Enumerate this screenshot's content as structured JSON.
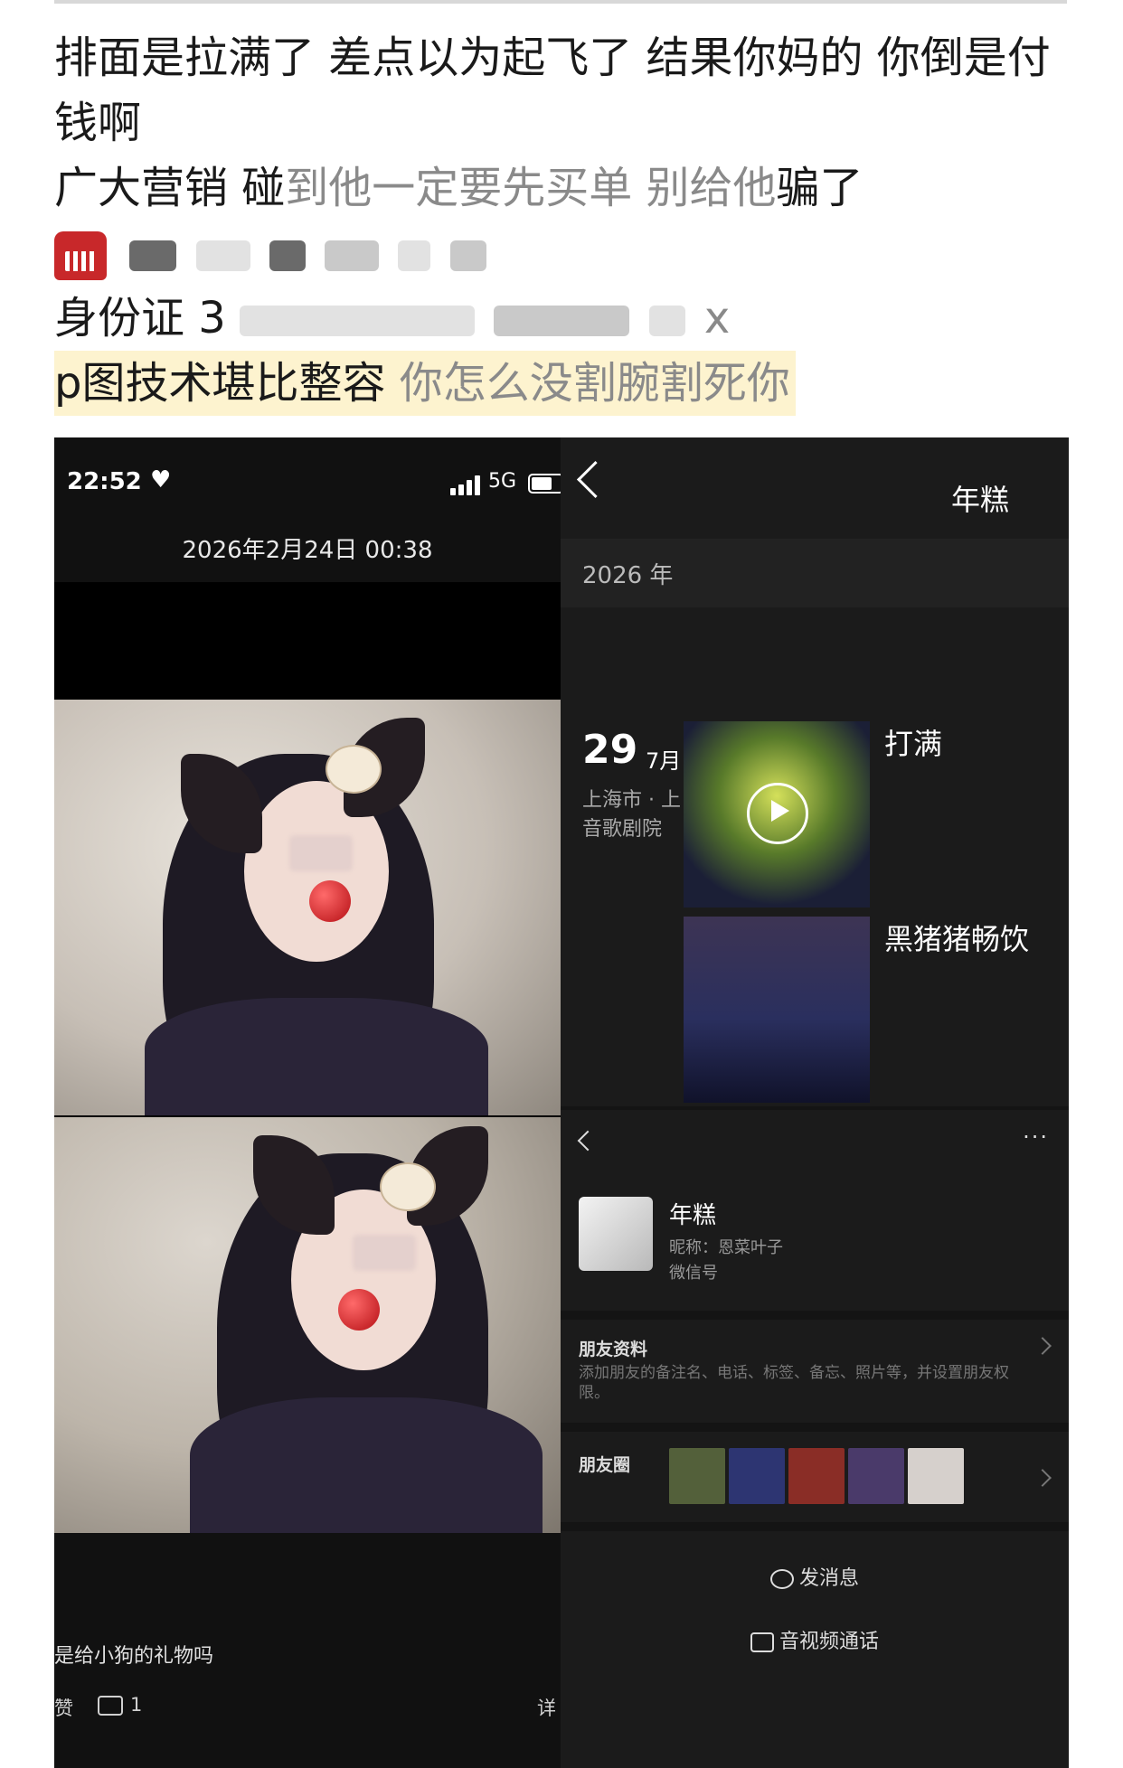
{
  "post": {
    "line1": "排面是拉满了 差点以为起飞了 结果你妈的 你倒是付钱啊",
    "line2a": "广大营销 碰",
    "line2b": "到他一定要先买单 别给他",
    "line2c": "骗了",
    "phone_icon": "telephone-icon",
    "id_prefix": "身份证 3",
    "id_suffix": "x",
    "line5a": "p图技术堪比整容",
    "line5b": " 你怎么没割腕割死你"
  },
  "left_screen": {
    "status_time": "22:52",
    "status_network": "5G",
    "date": "2026年2月24日 00:38",
    "caption": "是给小狗的礼物吗",
    "like_label": "赞",
    "comment_count": "1",
    "detail_label": "详"
  },
  "right_screen": {
    "title": "年糕",
    "year": "2026 年",
    "day": "29",
    "month": "7月",
    "location": "上海市 · 上音歌剧院",
    "post1_text": "打满",
    "post2_text": "黑猪猪畅饮",
    "more": "···",
    "profile": {
      "name": "年糕",
      "nickname": "昵称：恩菜叶子",
      "wechat_id": "微信号"
    },
    "friend_info_label": "朋友资料",
    "friend_info_desc": "添加朋友的备注名、电话、标签、备忘、照片等，并设置朋友权限。",
    "moments_label": "朋友圈",
    "send_message": "发消息",
    "video_call": "音视频通话"
  },
  "colors": {
    "highlight": "#fdf3cf",
    "dark_bg": "#1b1b1b"
  }
}
